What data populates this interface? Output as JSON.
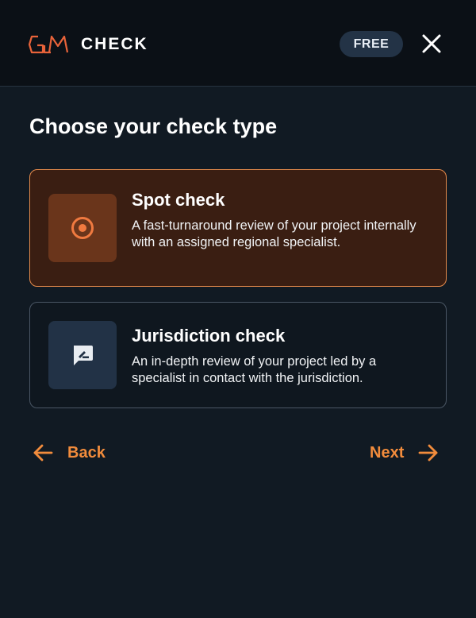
{
  "header": {
    "logo_text": "GM",
    "app_title": "CHECK",
    "badge": "FREE",
    "close_icon": "close-icon"
  },
  "main": {
    "title": "Choose your check type",
    "options": [
      {
        "title": "Spot check",
        "description": "A fast-turnaround review of your project internally with an assigned regional specialist.",
        "icon": "target-icon",
        "selected": true
      },
      {
        "title": "Jurisdiction check",
        "description": "An in-depth review of your project led by a specialist in contact with the jurisdiction.",
        "icon": "message-edit-icon",
        "selected": false
      }
    ]
  },
  "footer_nav": {
    "back_label": "Back",
    "next_label": "Next"
  },
  "colors": {
    "accent": "#f28c3c",
    "selected_bg": "#3a1e12",
    "selected_border": "#e58a4b",
    "background": "#111a23",
    "header_bg": "#0b1016",
    "badge_bg": "#233346"
  }
}
